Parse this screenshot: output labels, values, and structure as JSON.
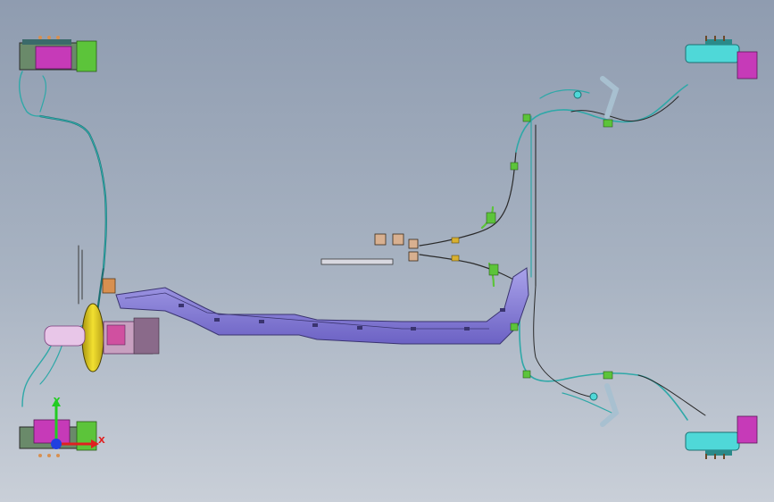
{
  "viewport": {
    "background_top": "#8f9cb0",
    "background_bottom": "#c9cfd8"
  },
  "triad": {
    "y_label": "Y",
    "x_label": "X",
    "y_color": "#22cc22",
    "x_color": "#e02020",
    "z_color": "#2040e0"
  },
  "colors": {
    "brake_line": "#2fa8a8",
    "brake_line_dark": "#1c6f72",
    "subframe": "#8a80d8",
    "subframe_stroke": "#3a3470",
    "booster": "#e6d21c",
    "hub_magenta": "#c63ab8",
    "hub_cyan": "#4fd8d8",
    "fitting_green": "#5cc43a",
    "bracket_orange": "#d89050"
  },
  "components": [
    {
      "name": "front-left-brake-assembly",
      "icon": "brake-caliper-icon"
    },
    {
      "name": "front-right-brake-assembly",
      "icon": "brake-caliper-icon"
    },
    {
      "name": "rear-left-brake-assembly",
      "icon": "brake-disc-icon"
    },
    {
      "name": "rear-right-brake-assembly",
      "icon": "brake-disc-icon"
    },
    {
      "name": "brake-booster",
      "icon": "booster-icon"
    },
    {
      "name": "center-subframe",
      "icon": "frame-icon"
    },
    {
      "name": "brake-line-network",
      "icon": "pipe-icon"
    }
  ]
}
